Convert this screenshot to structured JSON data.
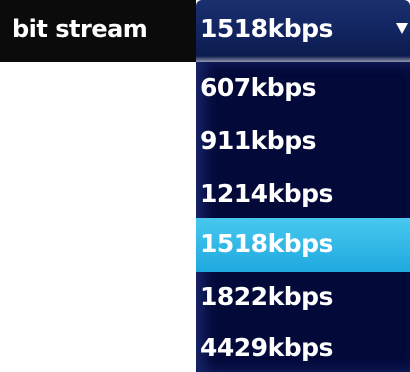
{
  "setting": {
    "label": "bit stream"
  },
  "select": {
    "current_value": "1518kbps",
    "chevron_icon": "chevron-down-icon",
    "options": [
      {
        "label": "607kbps",
        "selected": false
      },
      {
        "label": "911kbps",
        "selected": false
      },
      {
        "label": "1214kbps",
        "selected": false
      },
      {
        "label": "1518kbps",
        "selected": true
      },
      {
        "label": "1822kbps",
        "selected": false
      },
      {
        "label": "4429kbps",
        "selected": false
      }
    ]
  },
  "colors": {
    "highlight": "#1fa9e0",
    "list_background": "#030a3a",
    "label_background": "#0b0b0b"
  }
}
